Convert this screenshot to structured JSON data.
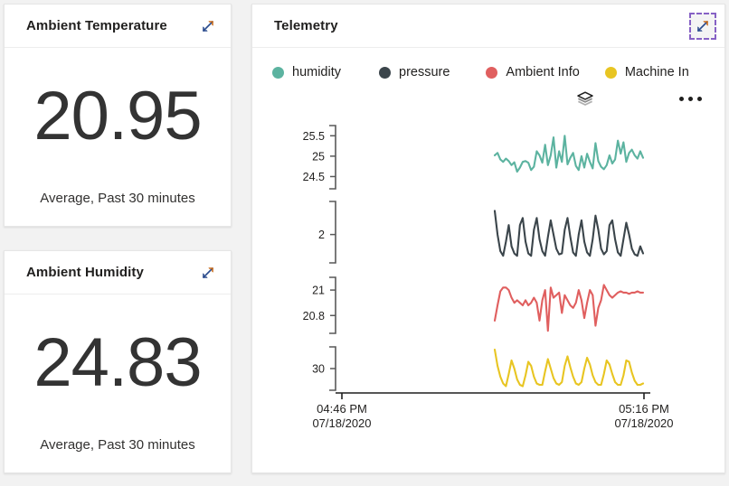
{
  "theme": {
    "page_background": "#f2f2f2",
    "card_background": "#ffffff",
    "text_color": "#201f1e",
    "focus_outline": "#8661c5"
  },
  "kpi_cards": [
    {
      "title": "Ambient Temperature",
      "value": "20.95",
      "caption": "Average, Past 30 minutes",
      "expand_icon": "expand-diagonal-arrows-icon"
    },
    {
      "title": "Ambient Humidity",
      "value": "24.83",
      "caption": "Average, Past 30 minutes",
      "expand_icon": "expand-diagonal-arrows-icon"
    }
  ],
  "telemetry": {
    "title": "Telemetry",
    "expand_icon": "expand-diagonal-arrows-icon",
    "expand_focused": true,
    "layers_icon": "layers-stack-icon",
    "more_icon": "ellipsis-horizontal-icon",
    "legend": [
      {
        "label": "humidity",
        "color": "#5cb3a0"
      },
      {
        "label": "pressure",
        "color": "#3b454b"
      },
      {
        "label": "Ambient Info",
        "color": "#e05f5f"
      },
      {
        "label": "Machine In",
        "color": "#e8c522"
      }
    ]
  },
  "chart_data": {
    "type": "line",
    "title": "Telemetry",
    "xlabel": "",
    "ylabel": "",
    "grid": false,
    "legend_position": "top",
    "x_axis": {
      "type": "time",
      "tick_labels": [
        {
          "time": "04:46 PM",
          "date": "07/18/2020"
        },
        {
          "time": "05:16 PM",
          "date": "07/18/2020"
        }
      ],
      "range": [
        "2020-07-18T16:46",
        "2020-07-18T17:16"
      ]
    },
    "panels": [
      {
        "series_name": "humidity",
        "color": "#5cb3a0",
        "y_ticks": [
          24.5,
          25,
          25.5
        ],
        "ylim": [
          24.2,
          25.75
        ],
        "values": [
          25.02,
          25.08,
          24.92,
          24.86,
          24.94,
          24.88,
          24.78,
          24.85,
          24.62,
          24.72,
          24.86,
          24.88,
          24.84,
          24.66,
          24.74,
          25.12,
          25.02,
          24.84,
          25.28,
          24.78,
          25.02,
          25.46,
          24.72,
          25.12,
          24.86,
          25.5,
          24.8,
          24.96,
          25.08,
          24.76,
          24.66,
          25.0,
          24.72,
          25.06,
          24.86,
          24.7,
          25.32,
          24.88,
          24.74,
          24.68,
          24.78,
          25.02,
          24.82,
          24.92,
          25.38,
          25.06,
          25.34,
          24.86,
          25.08,
          25.16,
          25.02,
          24.94,
          25.12,
          24.96
        ]
      },
      {
        "series_name": "pressure",
        "color": "#3b454b",
        "y_ticks": [
          2
        ],
        "ylim": [
          1.94,
          2.07
        ],
        "values": [
          2.05,
          2.0,
          1.965,
          1.955,
          1.985,
          2.02,
          1.975,
          1.96,
          1.955,
          2.02,
          2.035,
          1.985,
          1.96,
          1.955,
          2.01,
          2.035,
          1.99,
          1.965,
          1.955,
          1.995,
          2.03,
          2.0,
          1.97,
          1.958,
          1.96,
          2.01,
          2.035,
          1.995,
          1.962,
          1.955,
          2.0,
          2.03,
          1.985,
          1.962,
          1.955,
          1.99,
          2.04,
          2.01,
          1.97,
          1.958,
          1.965,
          2.02,
          2.03,
          1.99,
          1.962,
          1.955,
          1.99,
          2.025,
          2.0,
          1.97,
          1.958,
          1.955,
          1.975,
          1.96
        ]
      },
      {
        "series_name": "Ambient Info",
        "color": "#e05f5f",
        "y_ticks": [
          20.8,
          21
        ],
        "ylim": [
          20.66,
          21.1
        ],
        "values": [
          20.76,
          20.88,
          20.99,
          21.02,
          21.02,
          21.0,
          20.94,
          20.9,
          20.92,
          20.9,
          20.88,
          20.92,
          20.88,
          20.9,
          20.94,
          20.9,
          20.76,
          20.92,
          21.0,
          20.68,
          21.02,
          20.94,
          20.96,
          20.98,
          20.82,
          20.96,
          20.92,
          20.88,
          20.86,
          20.9,
          21.0,
          20.92,
          20.78,
          20.9,
          21.0,
          20.96,
          20.72,
          20.86,
          20.92,
          21.04,
          21.0,
          20.96,
          20.94,
          20.96,
          20.98,
          20.99,
          20.98,
          20.98,
          20.97,
          20.98,
          20.98,
          20.99,
          20.98,
          20.98
        ]
      },
      {
        "series_name": "Machine In",
        "color": "#e8c522",
        "y_ticks": [
          30
        ],
        "ylim": [
          28.4,
          31.6
        ],
        "values": [
          31.4,
          30.2,
          29.4,
          28.9,
          28.7,
          29.6,
          30.6,
          30.0,
          29.2,
          28.8,
          28.7,
          29.5,
          30.5,
          30.2,
          29.4,
          28.9,
          28.8,
          28.8,
          29.8,
          30.7,
          30.0,
          29.3,
          28.9,
          28.8,
          29.0,
          30.2,
          30.9,
          30.1,
          29.4,
          28.9,
          28.8,
          29.0,
          30.0,
          30.8,
          30.3,
          29.5,
          29.0,
          28.8,
          28.8,
          29.6,
          30.6,
          30.3,
          29.6,
          29.0,
          28.8,
          28.8,
          29.5,
          30.6,
          30.5,
          29.7,
          29.1,
          28.8,
          28.8,
          28.9
        ]
      }
    ]
  }
}
